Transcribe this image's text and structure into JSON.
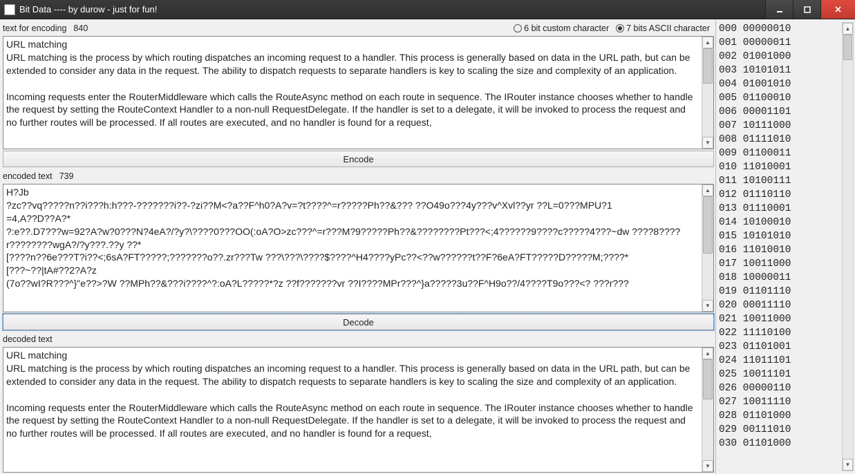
{
  "window": {
    "title": "Bit Data  ----  by durow - just for fun!"
  },
  "labels": {
    "text_for_encoding": "text for encoding",
    "encoded_text": "encoded text",
    "decoded_text": "decoded text"
  },
  "counts": {
    "input": "840",
    "encoded": "739"
  },
  "radios": {
    "opt6": "6 bit custom character",
    "opt7": "7 bits ASCII character",
    "selected": "opt7"
  },
  "buttons": {
    "encode": "Encode",
    "decode": "Decode"
  },
  "input_text": "URL matching\nURL matching is the process by which routing dispatches an incoming request to a handler. This process is generally based on data in the URL path, but can be extended to consider any data in the request. The ability to dispatch requests to separate handlers is key to scaling the size and complexity of an application.\n\nIncoming requests enter the RouterMiddleware which calls the RouteAsync method on each route in sequence. The IRouter instance chooses whether to handle the request by setting the RouteContext Handler to a non-null RequestDelegate. If the handler is set to a delegate, it will be invoked to process the request and no further routes will be processed. If all routes are executed, and no handler is found for a request,",
  "encoded_output": "H?Jb\n?zc??vq?????n??i???h:h???-???????i??-?zi??M<?a??F^h0?A?v=?t????^=r?????Ph??&??? ??O49o???4y???v^Xvl??yr ??L=0???MPU?1\n=4,A??D??A?*\n?:e??.D7???w=92?A?w?0???N?4eA?/?y?\\????0???OO(:oA?O>zc???^=r???M?9?????Ph??&????????Pt???<;4??????9????c?????4???~dw ????8????r????????wgA?/?y???.??y ??*\n[????n??6e???T?i??<;6sA?FT?????;???????o??.zr???Tw ???\\???\\????$????^H4????yPc??<??w??????t??F?6eA?FT?????D?????M;????*\n[???~??|tA#??2?A?z\n(7o??wI?R???^}\"e??>?W ??MPh??&???i????^?:oA?L?????*?z ??f???????vr ??I????MPr???^}a?????3u??F^H9o??/4????T9o???<? ???r???",
  "decoded_output": "URL matching\nURL matching is the process by which routing dispatches an incoming request to a handler. This process is generally based on data in the URL path, but can be extended to consider any data in the request. The ability to dispatch requests to separate handlers is key to scaling the size and complexity of an application.\n\nIncoming requests enter the RouterMiddleware which calls the RouteAsync method on each route in sequence. The IRouter instance chooses whether to handle the request by setting the RouteContext Handler to a non-null RequestDelegate. If the handler is set to a delegate, it will be invoked to process the request and no further routes will be processed. If all routes are executed, and no handler is found for a request,",
  "bit_lines": [
    "000 00000010",
    "001 00000011",
    "002 01001000",
    "003 10101011",
    "004 01001010",
    "005 01100010",
    "006 00001101",
    "007 10111000",
    "008 01111010",
    "009 01100011",
    "010 11010001",
    "011 10100111",
    "012 01110110",
    "013 01110001",
    "014 10100010",
    "015 10101010",
    "016 11010010",
    "017 10011000",
    "018 10000011",
    "019 01101110",
    "020 00011110",
    "021 10011000",
    "022 11110100",
    "023 01101001",
    "024 11011101",
    "025 10011101",
    "026 00000110",
    "027 10011110",
    "028 01101000",
    "029 00111010",
    "030 01101000"
  ]
}
